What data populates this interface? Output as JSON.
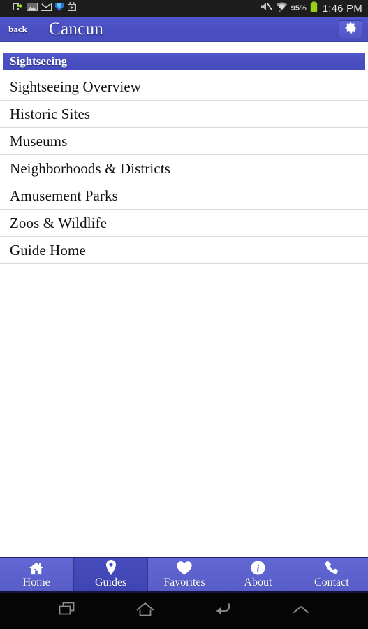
{
  "statusbar": {
    "left_icons": [
      {
        "name": "usb-transfer-icon"
      },
      {
        "name": "gallery-image-icon"
      },
      {
        "name": "gmail-icon"
      },
      {
        "name": "shield-app-icon"
      },
      {
        "name": "play-store-icon"
      }
    ],
    "mute_icon": "mute-icon",
    "wifi_icon": "wifi-icon",
    "battery_percent": "95%",
    "battery_icon": "battery-icon",
    "time": "1:46 PM"
  },
  "titlebar": {
    "back_label": "back",
    "title": "Cancun",
    "settings_icon": "gear-icon"
  },
  "section": {
    "header": "Sightseeing"
  },
  "list": {
    "items": [
      {
        "label": "Sightseeing Overview"
      },
      {
        "label": "Historic Sites"
      },
      {
        "label": "Museums"
      },
      {
        "label": "Neighborhoods & Districts"
      },
      {
        "label": "Amusement Parks"
      },
      {
        "label": "Zoos & Wildlife"
      },
      {
        "label": "Guide Home"
      }
    ]
  },
  "tabbar": {
    "tabs": [
      {
        "label": "Home",
        "icon": "home-icon",
        "active": false
      },
      {
        "label": "Guides",
        "icon": "map-pin-icon",
        "active": true
      },
      {
        "label": "Favorites",
        "icon": "heart-icon",
        "active": false
      },
      {
        "label": "About",
        "icon": "info-circle-icon",
        "active": false
      },
      {
        "label": "Contact",
        "icon": "phone-icon",
        "active": false
      }
    ]
  },
  "navbar": {
    "buttons": [
      {
        "name": "recents-icon"
      },
      {
        "name": "home-icon"
      },
      {
        "name": "back-icon"
      },
      {
        "name": "chevron-up-icon"
      }
    ]
  },
  "colors": {
    "brand": "#4a50c2",
    "brand_active": "#474cbd",
    "tab_bg": "#5b60cc",
    "status_bg": "#1d1d1d",
    "battery_green": "#9ad018",
    "separator": "#d9d9d9"
  }
}
